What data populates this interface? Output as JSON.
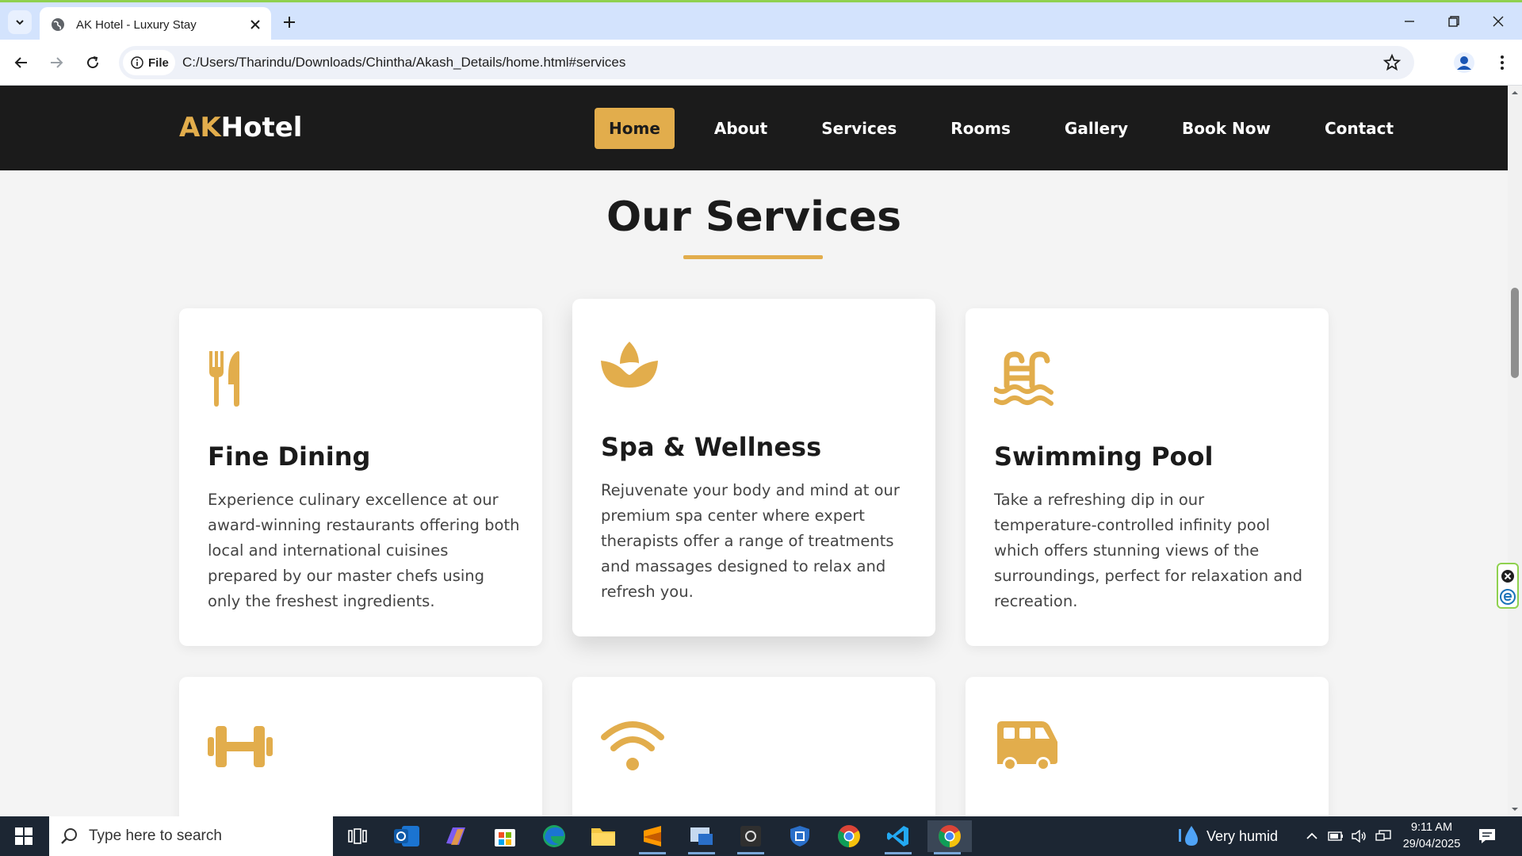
{
  "browser": {
    "tab_title": "AK Hotel - Luxury Stay",
    "site_chip": "File",
    "url": "C:/Users/Tharindu/Downloads/Chintha/Akash_Details/home.html#services"
  },
  "site": {
    "logo_accent": "AK",
    "logo_rest": "Hotel",
    "nav": [
      {
        "label": "Home",
        "active": true
      },
      {
        "label": "About"
      },
      {
        "label": "Services"
      },
      {
        "label": "Rooms"
      },
      {
        "label": "Gallery"
      },
      {
        "label": "Book Now"
      },
      {
        "label": "Contact"
      }
    ],
    "accent_color": "#e2ad4c",
    "nav_bg": "#1b1b1b"
  },
  "services": {
    "heading": "Our Services",
    "cards": [
      {
        "icon": "utensils-icon",
        "title": "Fine Dining",
        "text": "Experience culinary excellence at our award-winning restaurants offering both local and international cuisines prepared by our master chefs using only the freshest ingredients."
      },
      {
        "icon": "spa-lotus-icon",
        "title": "Spa & Wellness",
        "text": "Rejuvenate your body and mind at our premium spa center where expert therapists offer a range of treatments and massages designed to relax and refresh you."
      },
      {
        "icon": "swimming-pool-icon",
        "title": "Swimming Pool",
        "text": "Take a refreshing dip in our temperature-controlled infinity pool which offers stunning views of the surroundings, perfect for relaxation and recreation."
      },
      {
        "icon": "dumbbell-icon"
      },
      {
        "icon": "wifi-icon"
      },
      {
        "icon": "shuttle-bus-icon"
      }
    ]
  },
  "taskbar": {
    "search_placeholder": "Type here to search",
    "weather": "Very humid",
    "time": "9:11 AM",
    "date": "29/04/2025"
  }
}
